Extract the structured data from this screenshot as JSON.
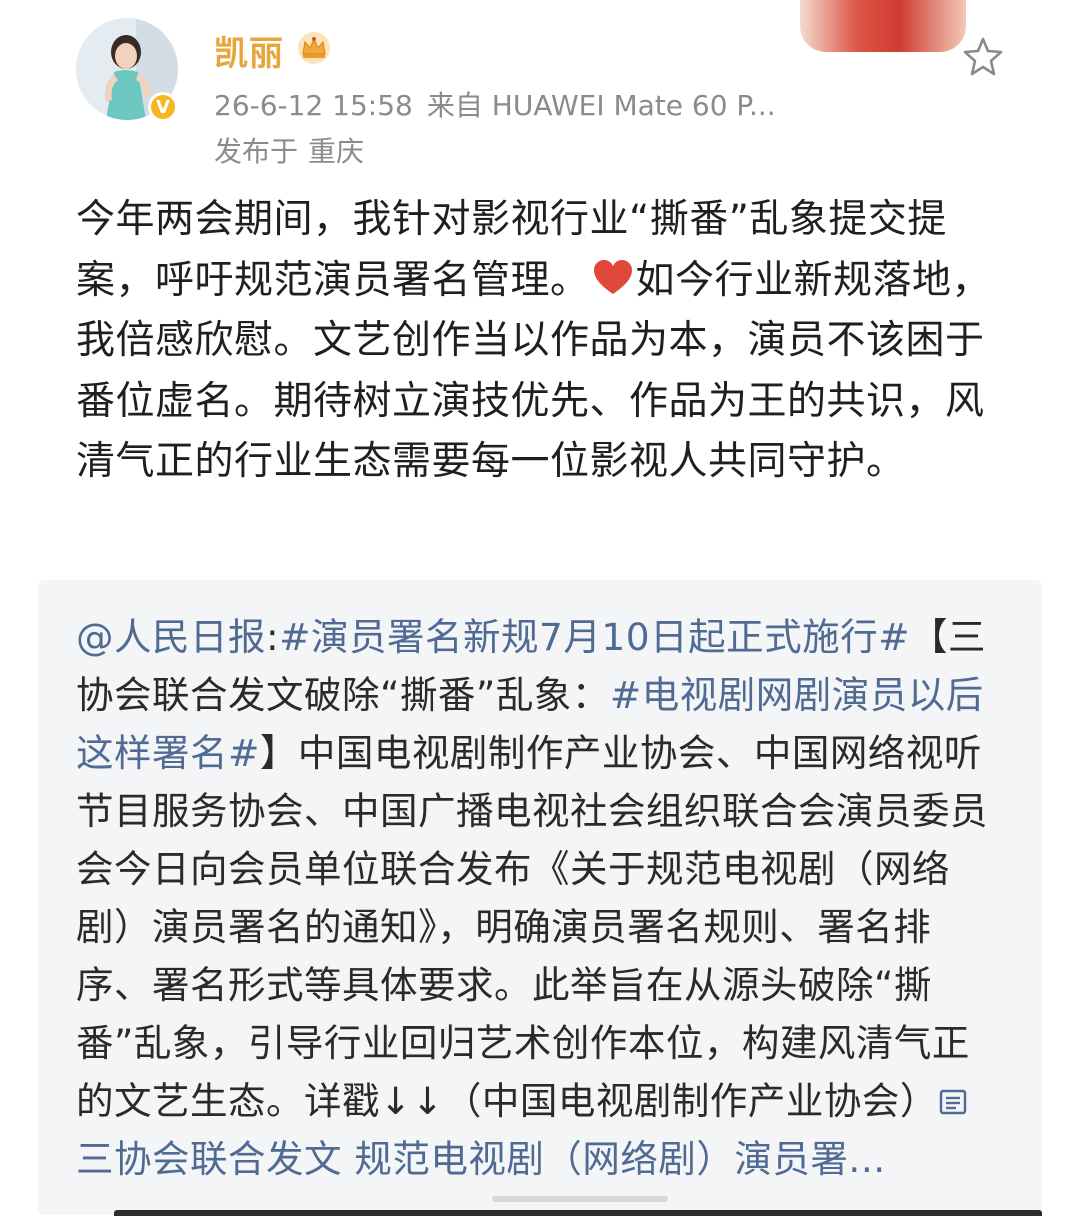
{
  "user": {
    "name": "凯丽",
    "verified": "V",
    "timestamp": "26-6-12 15:58",
    "source": "来自 HUAWEI Mate 60 P...",
    "location_prefix": "发布于",
    "location": "重庆"
  },
  "post": {
    "text_part1": "今年两会期间，我针对影视行业“撕番”乱象提交提案，呼吁规范演员署名管理。",
    "text_part2": "如今行业新规落地，我倍感欣慰。文艺创作当以作品为本，演员不该困于番位虚名。期待树立演技优先、作品为王的共识，风清气正的行业生态需要每一位影视人共同守护。"
  },
  "repost": {
    "author": "@人民日报",
    "colon": ":",
    "hashtag1": "#演员署名新规7月10日起正式施行#",
    "text1": "【三协会联合发文破除“撕番”乱象：",
    "hashtag2": "#电视剧网剧演员以后这样署名#",
    "text2": "】中国电视剧制作产业协会、中国网络视听节目服务协会、中国广播电视社会组织联合会演员委员会今日向会员单位联合发布《关于规范电视剧（网络剧）演员署名的通知》，明确演员署名规则、署名排序、署名形式等具体要求。此举旨在从源头破除“撕番”乱象，引导行业回归艺术创作本位，构建风清气正的文艺生态。详戳↓↓（中国电视剧制作产业协会）",
    "link_text": "三协会联合发文 规范电视剧（网络剧）演员署..."
  },
  "colors": {
    "username": "#e8a53c",
    "link": "#4f6b93",
    "meta": "#8b8b8b",
    "badge": "#f5b624",
    "heart": "#e0493a"
  },
  "icons": {
    "crown": "crown-icon",
    "star": "star-icon",
    "heart": "heart-icon",
    "link": "link-icon"
  }
}
